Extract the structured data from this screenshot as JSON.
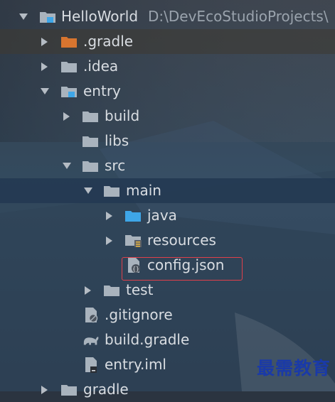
{
  "project_tree": {
    "root": {
      "label": "HelloWorld",
      "path": "D:\\DevEcoStudioProjects\\",
      "icon": "project-folder-icon"
    },
    "items": [
      {
        "label": ".gradle",
        "icon": "folder-excluded-icon",
        "color": "#d8752f"
      },
      {
        "label": ".idea",
        "icon": "folder-icon",
        "color": "#a9b3bd"
      },
      {
        "label": "entry",
        "icon": "module-folder-icon",
        "color": "#a9b3bd"
      },
      {
        "label": "build",
        "icon": "folder-icon",
        "color": "#a9b3bd"
      },
      {
        "label": "libs",
        "icon": "folder-icon",
        "color": "#a9b3bd"
      },
      {
        "label": "src",
        "icon": "folder-icon",
        "color": "#a9b3bd"
      },
      {
        "label": "main",
        "icon": "folder-icon",
        "color": "#a9b3bd"
      },
      {
        "label": "java",
        "icon": "source-folder-icon",
        "color": "#3ea6e8"
      },
      {
        "label": "resources",
        "icon": "resource-folder-icon",
        "color": "#a9b3bd"
      },
      {
        "label": "config.json",
        "icon": "json-file-icon",
        "color": "#a9b3bd"
      },
      {
        "label": "test",
        "icon": "folder-icon",
        "color": "#a9b3bd"
      },
      {
        "label": ".gitignore",
        "icon": "gitignore-file-icon",
        "color": "#a9b3bd"
      },
      {
        "label": "build.gradle",
        "icon": "gradle-file-icon",
        "color": "#a9b3bd"
      },
      {
        "label": "entry.iml",
        "icon": "iml-file-icon",
        "color": "#a9b3bd"
      },
      {
        "label": "gradle",
        "icon": "folder-icon",
        "color": "#a9b3bd"
      }
    ]
  },
  "watermark": "最需教育",
  "colors": {
    "highlight_border": "#e0404a",
    "selected_row": "#243a52",
    "text": "#d9dde2"
  }
}
